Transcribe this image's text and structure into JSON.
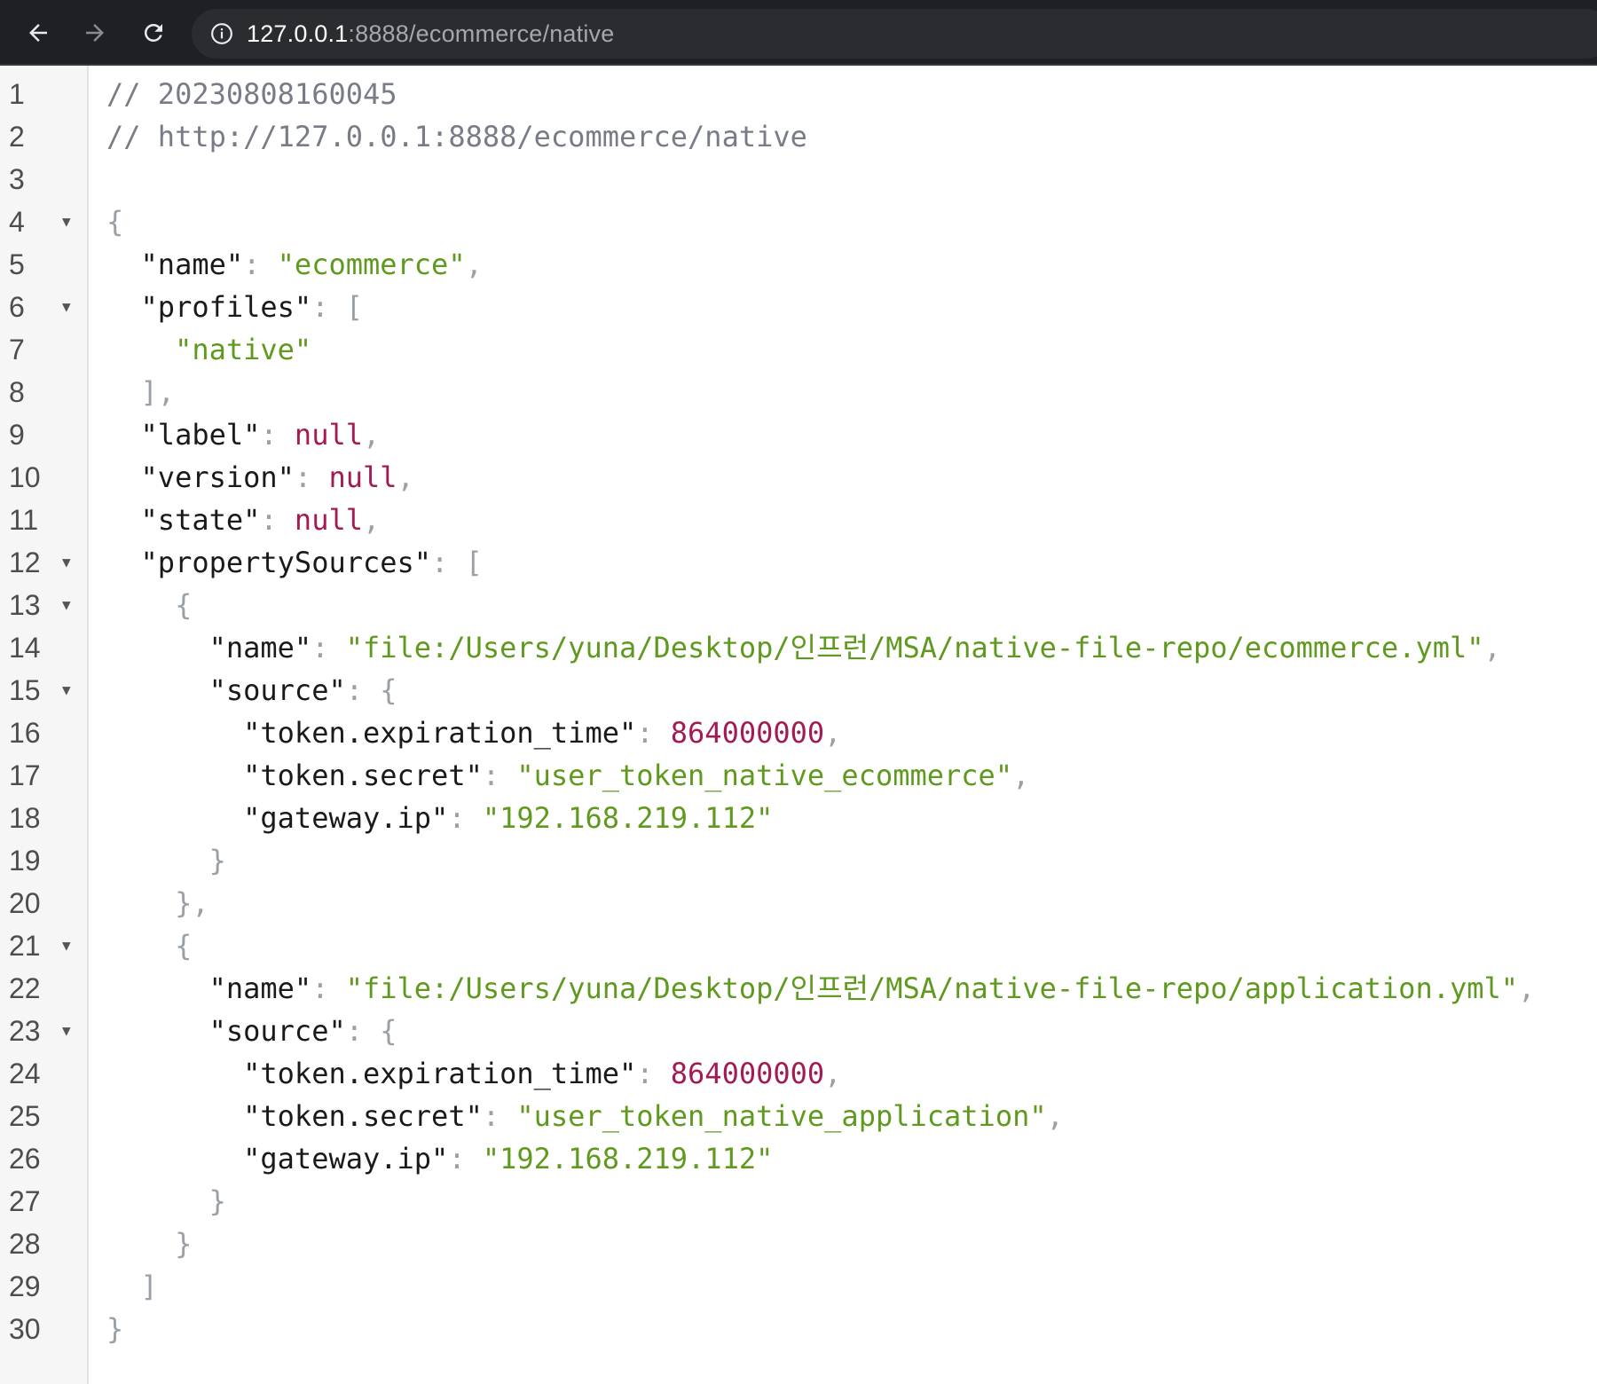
{
  "browser": {
    "url_host": "127.0.0.1",
    "url_path": ":8888/ecommerce/native",
    "icons": [
      "back-arrow-icon",
      "forward-arrow-icon",
      "reload-icon",
      "info-icon"
    ]
  },
  "colors": {
    "toolbar": "#1f2023",
    "string": "#5f9a1f",
    "number_null": "#a31b54",
    "comment": "#777c87"
  },
  "lines": [
    {
      "n": "1",
      "fold": "",
      "tokens": [
        [
          "c",
          "// 20230808160045"
        ]
      ]
    },
    {
      "n": "2",
      "fold": "",
      "tokens": [
        [
          "c",
          "// http://127.0.0.1:8888/ecommerce/native"
        ]
      ]
    },
    {
      "n": "3",
      "fold": "",
      "tokens": []
    },
    {
      "n": "4",
      "fold": "▼",
      "tokens": [
        [
          "p",
          "{"
        ]
      ]
    },
    {
      "n": "5",
      "fold": "",
      "tokens": [
        [
          "k",
          "  \"name\""
        ],
        [
          "p",
          ": "
        ],
        [
          "s",
          "\"ecommerce\""
        ],
        [
          "p",
          ","
        ]
      ]
    },
    {
      "n": "6",
      "fold": "▼",
      "tokens": [
        [
          "k",
          "  \"profiles\""
        ],
        [
          "p",
          ": ["
        ]
      ]
    },
    {
      "n": "7",
      "fold": "",
      "tokens": [
        [
          "s",
          "    \"native\""
        ]
      ]
    },
    {
      "n": "8",
      "fold": "",
      "tokens": [
        [
          "p",
          "  ],"
        ]
      ]
    },
    {
      "n": "9",
      "fold": "",
      "tokens": [
        [
          "k",
          "  \"label\""
        ],
        [
          "p",
          ": "
        ],
        [
          "nl",
          "null"
        ],
        [
          "p",
          ","
        ]
      ]
    },
    {
      "n": "10",
      "fold": "",
      "tokens": [
        [
          "k",
          "  \"version\""
        ],
        [
          "p",
          ": "
        ],
        [
          "nl",
          "null"
        ],
        [
          "p",
          ","
        ]
      ]
    },
    {
      "n": "11",
      "fold": "",
      "tokens": [
        [
          "k",
          "  \"state\""
        ],
        [
          "p",
          ": "
        ],
        [
          "nl",
          "null"
        ],
        [
          "p",
          ","
        ]
      ]
    },
    {
      "n": "12",
      "fold": "▼",
      "tokens": [
        [
          "k",
          "  \"propertySources\""
        ],
        [
          "p",
          ": ["
        ]
      ]
    },
    {
      "n": "13",
      "fold": "▼",
      "tokens": [
        [
          "p",
          "    {"
        ]
      ]
    },
    {
      "n": "14",
      "fold": "",
      "tokens": [
        [
          "k",
          "      \"name\""
        ],
        [
          "p",
          ": "
        ],
        [
          "s",
          "\"file:/Users/yuna/Desktop/인프런/MSA/native-file-repo/ecommerce.yml\""
        ],
        [
          "p",
          ","
        ]
      ]
    },
    {
      "n": "15",
      "fold": "▼",
      "tokens": [
        [
          "k",
          "      \"source\""
        ],
        [
          "p",
          ": {"
        ]
      ]
    },
    {
      "n": "16",
      "fold": "",
      "tokens": [
        [
          "k",
          "        \"token.expiration_time\""
        ],
        [
          "p",
          ": "
        ],
        [
          "n",
          "864000000"
        ],
        [
          "p",
          ","
        ]
      ]
    },
    {
      "n": "17",
      "fold": "",
      "tokens": [
        [
          "k",
          "        \"token.secret\""
        ],
        [
          "p",
          ": "
        ],
        [
          "s",
          "\"user_token_native_ecommerce\""
        ],
        [
          "p",
          ","
        ]
      ]
    },
    {
      "n": "18",
      "fold": "",
      "tokens": [
        [
          "k",
          "        \"gateway.ip\""
        ],
        [
          "p",
          ": "
        ],
        [
          "s",
          "\"192.168.219.112\""
        ]
      ]
    },
    {
      "n": "19",
      "fold": "",
      "tokens": [
        [
          "p",
          "      }"
        ]
      ]
    },
    {
      "n": "20",
      "fold": "",
      "tokens": [
        [
          "p",
          "    },"
        ]
      ]
    },
    {
      "n": "21",
      "fold": "▼",
      "tokens": [
        [
          "p",
          "    {"
        ]
      ]
    },
    {
      "n": "22",
      "fold": "",
      "tokens": [
        [
          "k",
          "      \"name\""
        ],
        [
          "p",
          ": "
        ],
        [
          "s",
          "\"file:/Users/yuna/Desktop/인프런/MSA/native-file-repo/application.yml\""
        ],
        [
          "p",
          ","
        ]
      ]
    },
    {
      "n": "23",
      "fold": "▼",
      "tokens": [
        [
          "k",
          "      \"source\""
        ],
        [
          "p",
          ": {"
        ]
      ]
    },
    {
      "n": "24",
      "fold": "",
      "tokens": [
        [
          "k",
          "        \"token.expiration_time\""
        ],
        [
          "p",
          ": "
        ],
        [
          "n",
          "864000000"
        ],
        [
          "p",
          ","
        ]
      ]
    },
    {
      "n": "25",
      "fold": "",
      "tokens": [
        [
          "k",
          "        \"token.secret\""
        ],
        [
          "p",
          ": "
        ],
        [
          "s",
          "\"user_token_native_application\""
        ],
        [
          "p",
          ","
        ]
      ]
    },
    {
      "n": "26",
      "fold": "",
      "tokens": [
        [
          "k",
          "        \"gateway.ip\""
        ],
        [
          "p",
          ": "
        ],
        [
          "s",
          "\"192.168.219.112\""
        ]
      ]
    },
    {
      "n": "27",
      "fold": "",
      "tokens": [
        [
          "p",
          "      }"
        ]
      ]
    },
    {
      "n": "28",
      "fold": "",
      "tokens": [
        [
          "p",
          "    }"
        ]
      ]
    },
    {
      "n": "29",
      "fold": "",
      "tokens": [
        [
          "p",
          "  ]"
        ]
      ]
    },
    {
      "n": "30",
      "fold": "",
      "tokens": [
        [
          "p",
          "}"
        ]
      ]
    }
  ]
}
